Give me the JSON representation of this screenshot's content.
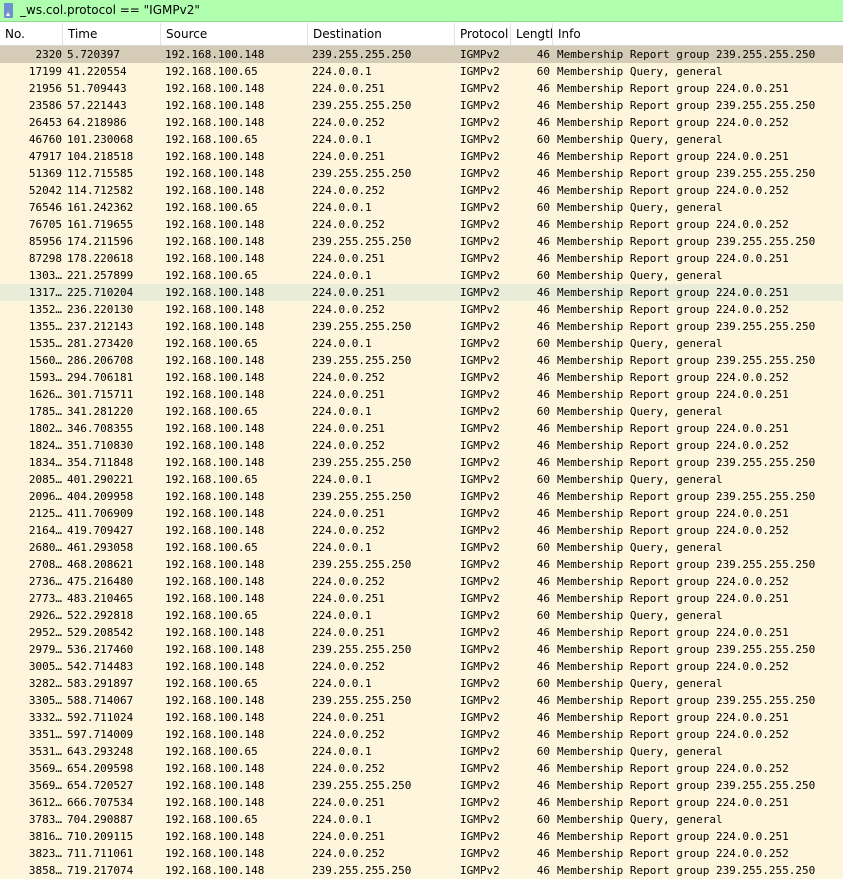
{
  "filter": {
    "text": "_ws.col.protocol == \"IGMPv2\""
  },
  "columns": [
    "No.",
    "Time",
    "Source",
    "Destination",
    "Protocol",
    "Lengtl",
    "Info"
  ],
  "packets": [
    {
      "no": "2320",
      "time": "5.720397",
      "src": "192.168.100.148",
      "dst": "239.255.255.250",
      "proto": "IGMPv2",
      "len": "46",
      "info": "Membership Report group 239.255.255.250"
    },
    {
      "no": "17199",
      "time": "41.220554",
      "src": "192.168.100.65",
      "dst": "224.0.0.1",
      "proto": "IGMPv2",
      "len": "60",
      "info": "Membership Query, general"
    },
    {
      "no": "21956",
      "time": "51.709443",
      "src": "192.168.100.148",
      "dst": "224.0.0.251",
      "proto": "IGMPv2",
      "len": "46",
      "info": "Membership Report group 224.0.0.251"
    },
    {
      "no": "23586",
      "time": "57.221443",
      "src": "192.168.100.148",
      "dst": "239.255.255.250",
      "proto": "IGMPv2",
      "len": "46",
      "info": "Membership Report group 239.255.255.250"
    },
    {
      "no": "26453",
      "time": "64.218986",
      "src": "192.168.100.148",
      "dst": "224.0.0.252",
      "proto": "IGMPv2",
      "len": "46",
      "info": "Membership Report group 224.0.0.252"
    },
    {
      "no": "46760",
      "time": "101.230068",
      "src": "192.168.100.65",
      "dst": "224.0.0.1",
      "proto": "IGMPv2",
      "len": "60",
      "info": "Membership Query, general"
    },
    {
      "no": "47917",
      "time": "104.218518",
      "src": "192.168.100.148",
      "dst": "224.0.0.251",
      "proto": "IGMPv2",
      "len": "46",
      "info": "Membership Report group 224.0.0.251"
    },
    {
      "no": "51369",
      "time": "112.715585",
      "src": "192.168.100.148",
      "dst": "239.255.255.250",
      "proto": "IGMPv2",
      "len": "46",
      "info": "Membership Report group 239.255.255.250"
    },
    {
      "no": "52042",
      "time": "114.712582",
      "src": "192.168.100.148",
      "dst": "224.0.0.252",
      "proto": "IGMPv2",
      "len": "46",
      "info": "Membership Report group 224.0.0.252"
    },
    {
      "no": "76546",
      "time": "161.242362",
      "src": "192.168.100.65",
      "dst": "224.0.0.1",
      "proto": "IGMPv2",
      "len": "60",
      "info": "Membership Query, general"
    },
    {
      "no": "76705",
      "time": "161.719655",
      "src": "192.168.100.148",
      "dst": "224.0.0.252",
      "proto": "IGMPv2",
      "len": "46",
      "info": "Membership Report group 224.0.0.252"
    },
    {
      "no": "85956",
      "time": "174.211596",
      "src": "192.168.100.148",
      "dst": "239.255.255.250",
      "proto": "IGMPv2",
      "len": "46",
      "info": "Membership Report group 239.255.255.250"
    },
    {
      "no": "87298",
      "time": "178.220618",
      "src": "192.168.100.148",
      "dst": "224.0.0.251",
      "proto": "IGMPv2",
      "len": "46",
      "info": "Membership Report group 224.0.0.251"
    },
    {
      "no": "1303…",
      "time": "221.257899",
      "src": "192.168.100.65",
      "dst": "224.0.0.1",
      "proto": "IGMPv2",
      "len": "60",
      "info": "Membership Query, general"
    },
    {
      "no": "1317…",
      "time": "225.710204",
      "src": "192.168.100.148",
      "dst": "224.0.0.251",
      "proto": "IGMPv2",
      "len": "46",
      "info": "Membership Report group 224.0.0.251"
    },
    {
      "no": "1352…",
      "time": "236.220130",
      "src": "192.168.100.148",
      "dst": "224.0.0.252",
      "proto": "IGMPv2",
      "len": "46",
      "info": "Membership Report group 224.0.0.252"
    },
    {
      "no": "1355…",
      "time": "237.212143",
      "src": "192.168.100.148",
      "dst": "239.255.255.250",
      "proto": "IGMPv2",
      "len": "46",
      "info": "Membership Report group 239.255.255.250"
    },
    {
      "no": "1535…",
      "time": "281.273420",
      "src": "192.168.100.65",
      "dst": "224.0.0.1",
      "proto": "IGMPv2",
      "len": "60",
      "info": "Membership Query, general"
    },
    {
      "no": "1560…",
      "time": "286.206708",
      "src": "192.168.100.148",
      "dst": "239.255.255.250",
      "proto": "IGMPv2",
      "len": "46",
      "info": "Membership Report group 239.255.255.250"
    },
    {
      "no": "1593…",
      "time": "294.706181",
      "src": "192.168.100.148",
      "dst": "224.0.0.252",
      "proto": "IGMPv2",
      "len": "46",
      "info": "Membership Report group 224.0.0.252"
    },
    {
      "no": "1626…",
      "time": "301.715711",
      "src": "192.168.100.148",
      "dst": "224.0.0.251",
      "proto": "IGMPv2",
      "len": "46",
      "info": "Membership Report group 224.0.0.251"
    },
    {
      "no": "1785…",
      "time": "341.281220",
      "src": "192.168.100.65",
      "dst": "224.0.0.1",
      "proto": "IGMPv2",
      "len": "60",
      "info": "Membership Query, general"
    },
    {
      "no": "1802…",
      "time": "346.708355",
      "src": "192.168.100.148",
      "dst": "224.0.0.251",
      "proto": "IGMPv2",
      "len": "46",
      "info": "Membership Report group 224.0.0.251"
    },
    {
      "no": "1824…",
      "time": "351.710830",
      "src": "192.168.100.148",
      "dst": "224.0.0.252",
      "proto": "IGMPv2",
      "len": "46",
      "info": "Membership Report group 224.0.0.252"
    },
    {
      "no": "1834…",
      "time": "354.711848",
      "src": "192.168.100.148",
      "dst": "239.255.255.250",
      "proto": "IGMPv2",
      "len": "46",
      "info": "Membership Report group 239.255.255.250"
    },
    {
      "no": "2085…",
      "time": "401.290221",
      "src": "192.168.100.65",
      "dst": "224.0.0.1",
      "proto": "IGMPv2",
      "len": "60",
      "info": "Membership Query, general"
    },
    {
      "no": "2096…",
      "time": "404.209958",
      "src": "192.168.100.148",
      "dst": "239.255.255.250",
      "proto": "IGMPv2",
      "len": "46",
      "info": "Membership Report group 239.255.255.250"
    },
    {
      "no": "2125…",
      "time": "411.706909",
      "src": "192.168.100.148",
      "dst": "224.0.0.251",
      "proto": "IGMPv2",
      "len": "46",
      "info": "Membership Report group 224.0.0.251"
    },
    {
      "no": "2164…",
      "time": "419.709427",
      "src": "192.168.100.148",
      "dst": "224.0.0.252",
      "proto": "IGMPv2",
      "len": "46",
      "info": "Membership Report group 224.0.0.252"
    },
    {
      "no": "2680…",
      "time": "461.293058",
      "src": "192.168.100.65",
      "dst": "224.0.0.1",
      "proto": "IGMPv2",
      "len": "60",
      "info": "Membership Query, general"
    },
    {
      "no": "2708…",
      "time": "468.208621",
      "src": "192.168.100.148",
      "dst": "239.255.255.250",
      "proto": "IGMPv2",
      "len": "46",
      "info": "Membership Report group 239.255.255.250"
    },
    {
      "no": "2736…",
      "time": "475.216480",
      "src": "192.168.100.148",
      "dst": "224.0.0.252",
      "proto": "IGMPv2",
      "len": "46",
      "info": "Membership Report group 224.0.0.252"
    },
    {
      "no": "2773…",
      "time": "483.210465",
      "src": "192.168.100.148",
      "dst": "224.0.0.251",
      "proto": "IGMPv2",
      "len": "46",
      "info": "Membership Report group 224.0.0.251"
    },
    {
      "no": "2926…",
      "time": "522.292818",
      "src": "192.168.100.65",
      "dst": "224.0.0.1",
      "proto": "IGMPv2",
      "len": "60",
      "info": "Membership Query, general"
    },
    {
      "no": "2952…",
      "time": "529.208542",
      "src": "192.168.100.148",
      "dst": "224.0.0.251",
      "proto": "IGMPv2",
      "len": "46",
      "info": "Membership Report group 224.0.0.251"
    },
    {
      "no": "2979…",
      "time": "536.217460",
      "src": "192.168.100.148",
      "dst": "239.255.255.250",
      "proto": "IGMPv2",
      "len": "46",
      "info": "Membership Report group 239.255.255.250"
    },
    {
      "no": "3005…",
      "time": "542.714483",
      "src": "192.168.100.148",
      "dst": "224.0.0.252",
      "proto": "IGMPv2",
      "len": "46",
      "info": "Membership Report group 224.0.0.252"
    },
    {
      "no": "3282…",
      "time": "583.291897",
      "src": "192.168.100.65",
      "dst": "224.0.0.1",
      "proto": "IGMPv2",
      "len": "60",
      "info": "Membership Query, general"
    },
    {
      "no": "3305…",
      "time": "588.714067",
      "src": "192.168.100.148",
      "dst": "239.255.255.250",
      "proto": "IGMPv2",
      "len": "46",
      "info": "Membership Report group 239.255.255.250"
    },
    {
      "no": "3332…",
      "time": "592.711024",
      "src": "192.168.100.148",
      "dst": "224.0.0.251",
      "proto": "IGMPv2",
      "len": "46",
      "info": "Membership Report group 224.0.0.251"
    },
    {
      "no": "3351…",
      "time": "597.714009",
      "src": "192.168.100.148",
      "dst": "224.0.0.252",
      "proto": "IGMPv2",
      "len": "46",
      "info": "Membership Report group 224.0.0.252"
    },
    {
      "no": "3531…",
      "time": "643.293248",
      "src": "192.168.100.65",
      "dst": "224.0.0.1",
      "proto": "IGMPv2",
      "len": "60",
      "info": "Membership Query, general"
    },
    {
      "no": "3569…",
      "time": "654.209598",
      "src": "192.168.100.148",
      "dst": "224.0.0.252",
      "proto": "IGMPv2",
      "len": "46",
      "info": "Membership Report group 224.0.0.252"
    },
    {
      "no": "3569…",
      "time": "654.720527",
      "src": "192.168.100.148",
      "dst": "239.255.255.250",
      "proto": "IGMPv2",
      "len": "46",
      "info": "Membership Report group 239.255.255.250"
    },
    {
      "no": "3612…",
      "time": "666.707534",
      "src": "192.168.100.148",
      "dst": "224.0.0.251",
      "proto": "IGMPv2",
      "len": "46",
      "info": "Membership Report group 224.0.0.251"
    },
    {
      "no": "3783…",
      "time": "704.290887",
      "src": "192.168.100.65",
      "dst": "224.0.0.1",
      "proto": "IGMPv2",
      "len": "60",
      "info": "Membership Query, general"
    },
    {
      "no": "3816…",
      "time": "710.209115",
      "src": "192.168.100.148",
      "dst": "224.0.0.251",
      "proto": "IGMPv2",
      "len": "46",
      "info": "Membership Report group 224.0.0.251"
    },
    {
      "no": "3823…",
      "time": "711.711061",
      "src": "192.168.100.148",
      "dst": "224.0.0.252",
      "proto": "IGMPv2",
      "len": "46",
      "info": "Membership Report group 224.0.0.252"
    },
    {
      "no": "3858…",
      "time": "719.217074",
      "src": "192.168.100.148",
      "dst": "239.255.255.250",
      "proto": "IGMPv2",
      "len": "46",
      "info": "Membership Report group 239.255.255.250"
    }
  ],
  "colors": {
    "filter_valid_bg": "#afffaf",
    "row_bg": "#fef6dc",
    "row_selected_bg": "#d4ccb6",
    "row_hover_bg": "#e9ecd8"
  }
}
